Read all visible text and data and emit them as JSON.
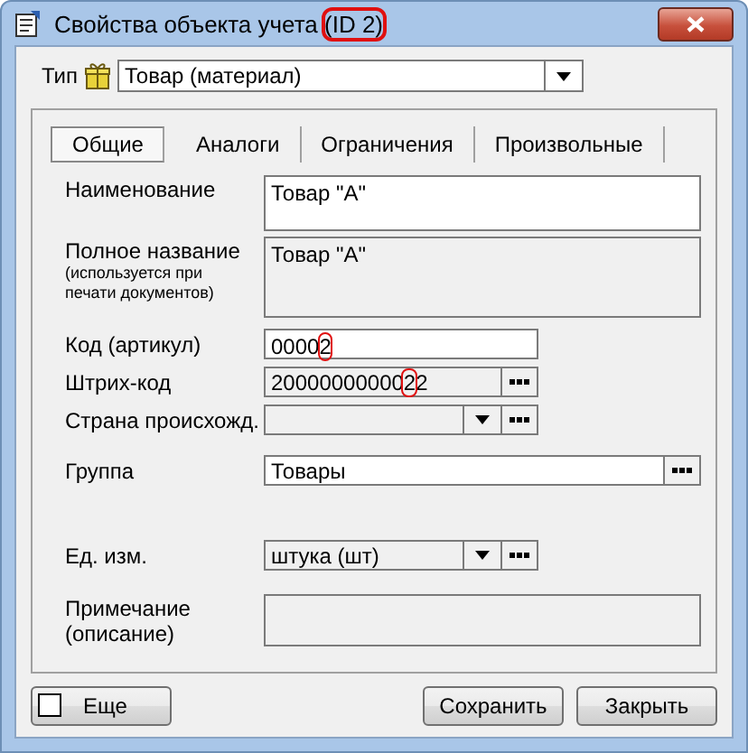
{
  "window": {
    "title_parts": [
      {
        "text": "Свойства объекта учета ",
        "circled": false
      },
      {
        "text": "(ID 2)",
        "circled": true
      }
    ]
  },
  "type_field": {
    "label": "Тип",
    "value": "Товар (материал)"
  },
  "tabs": [
    {
      "label": "Общие",
      "selected": true
    },
    {
      "label": "Аналоги",
      "selected": false
    },
    {
      "label": "Ограничения",
      "selected": false
    },
    {
      "label": "Произвольные",
      "selected": false
    }
  ],
  "fields": [
    {
      "kind": "multiline",
      "label": "Наименование",
      "value": [
        {
          "text": "Товар \"А\"",
          "circled": false
        }
      ],
      "editable": true
    },
    {
      "kind": "multiline",
      "label": "Полное название",
      "hint": "(используется при печати документов)",
      "value": [
        {
          "text": "Товар \"А\"",
          "circled": false
        }
      ],
      "editable": false
    },
    {
      "kind": "text",
      "label": "Код (артикул)",
      "value": [
        {
          "text": "0000",
          "circled": false
        },
        {
          "text": "2",
          "circled": true
        }
      ],
      "editable": true
    },
    {
      "kind": "lookup",
      "label": "Штрих-код",
      "value": [
        {
          "text": "20000000000",
          "circled": false
        },
        {
          "text": "2",
          "circled": true
        },
        {
          "text": "2",
          "circled": false
        }
      ],
      "editable": false
    },
    {
      "kind": "combo",
      "label": "Страна происхожд.",
      "editable": false
    },
    {
      "kind": "wide_lookup",
      "label": "Группа",
      "value": [
        {
          "text": "Товары",
          "circled": false
        }
      ],
      "editable": true
    },
    {
      "kind": "combo",
      "label": "Ед. изм.",
      "value": [
        {
          "text": "штука (шт)",
          "circled": false
        }
      ],
      "editable": false
    },
    {
      "kind": "note",
      "label": "Примечание (описание)",
      "editable": false
    }
  ],
  "more": {
    "label": "Еще",
    "checked": false
  },
  "buttons": [
    "Сохранить",
    "Закрыть"
  ]
}
